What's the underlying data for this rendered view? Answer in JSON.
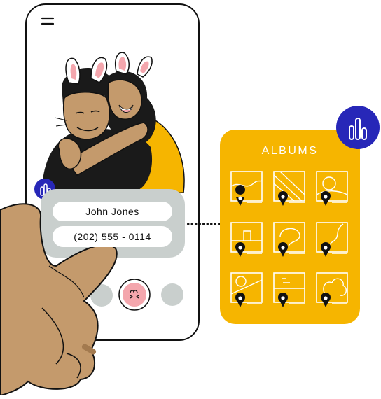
{
  "contact": {
    "name": "John Jones",
    "phone": "(202) 555 - 0114"
  },
  "albums": {
    "title": "ALBUMS",
    "count": 9
  },
  "colors": {
    "accent": "#f6b500",
    "brand_blue": "#2727b8",
    "card_gray": "#c9cfcd",
    "skin_hand": "#c49a6c",
    "hair": "#1a1a1a",
    "pink": "#f4a6ad"
  },
  "icons": [
    "menu-icon",
    "brand-logo-icon",
    "kiss-emoji-icon",
    "map-pin-icon"
  ]
}
